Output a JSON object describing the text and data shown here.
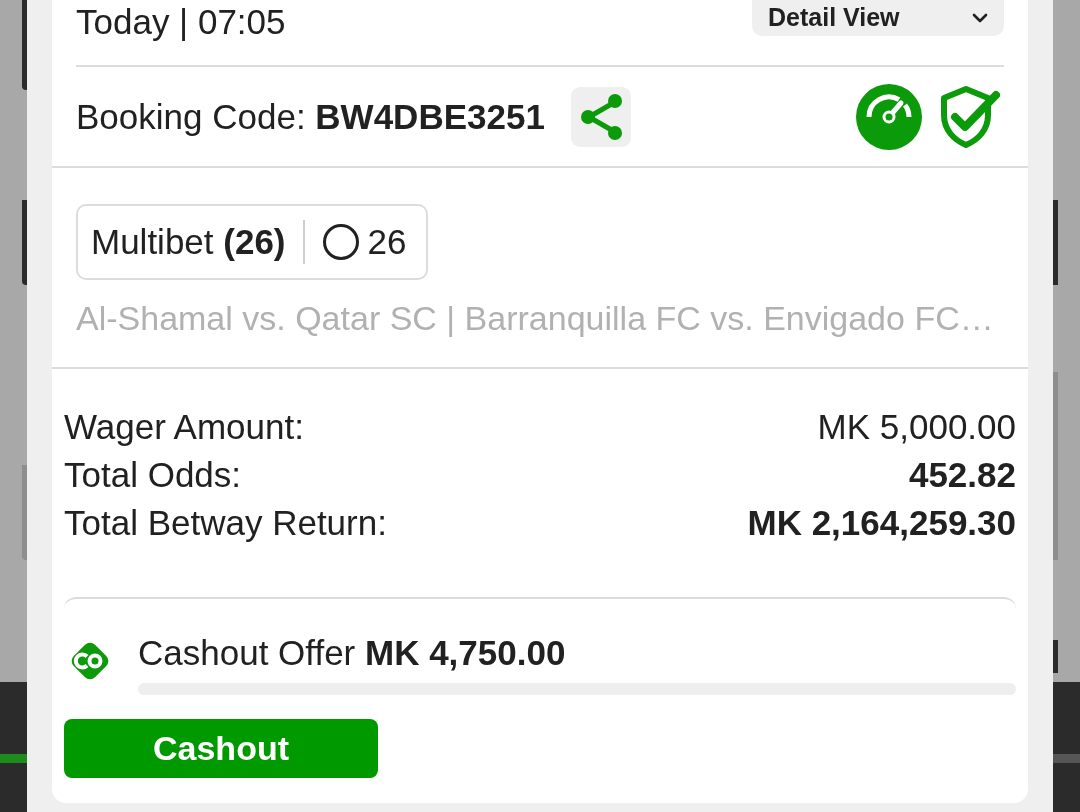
{
  "header": {
    "date_time": "Today | 07:05",
    "detail_button": {
      "label": "Detail View"
    }
  },
  "booking": {
    "code_line": "Booking Code: **BW4DBE3251**"
  },
  "bet_summary": {
    "bet_type": "Multibet **(26)**",
    "selection_count": "26",
    "matches": "Al-Shamal vs. Qatar SC | Barranquilla FC vs. Envigado FC…"
  },
  "totals": [
    {
      "label": "Wager Amount:",
      "value": "MK 5,000.00",
      "emphasized": false
    },
    {
      "label": "Total Odds:",
      "value": "452.82",
      "emphasized": true
    },
    {
      "label": "Total Betway Return:",
      "value": "MK 2,164,259.30",
      "emphasized": true
    }
  ],
  "cashout": {
    "offer": "Cashout Offer **MK 4,750.00**",
    "level": 0,
    "button": {
      "label": "Cashout"
    }
  }
}
